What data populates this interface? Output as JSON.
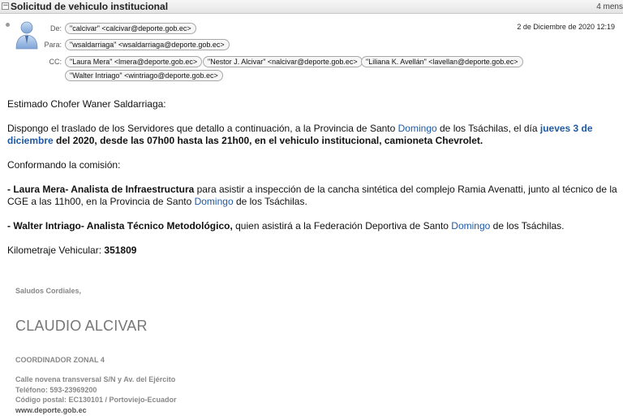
{
  "header": {
    "subject": "Solicitud de vehiculo institucional",
    "message_count": "4 mens",
    "date": "2 de Diciembre de 2020 12:19",
    "from_label": "De:",
    "to_label": "Para:",
    "cc_label": "CC:",
    "from": "\"calcivar\" <calcivar@deporte.gob.ec>",
    "to": "\"wsaldarriaga\" <wsaldarriaga@deporte.gob.ec>",
    "cc": [
      "\"Laura Mera\" <lmera@deporte.gob.ec>",
      "\"Nestor J. Alcivar\" <nalcivar@deporte.gob.ec>",
      "\"Liliana K. Avellán\" <lavellan@deporte.gob.ec>",
      "\"Walter Intriago\" <wintriago@deporte.gob.ec>"
    ]
  },
  "body": {
    "greeting": "Estimado Chofer Waner Saldarriaga:",
    "p1_a": "Dispongo el traslado de los Servidores  que detallo a continuación, a la Provincia de Santo ",
    "p1_link1": "Domingo",
    "p1_b": " de los Tsáchilas,  el día ",
    "p1_link2": "jueves 3 de diciembre",
    "p1_c": " del 2020, desde las 07h00 hasta las 21h00, en  el vehiculo institucional, camioneta Chevrolet.",
    "p2": "Conformando la comisión:",
    "p3_bold": "- Laura Mera- Analista de Infraestructura",
    "p3_a": " para asistir a inspección de la cancha sintética del complejo Ramia Avenatti, junto al técnico de la CGE a las 11h00, en la Provincia de Santo ",
    "p3_link": "Domingo",
    "p3_b": " de los Tsáchilas.",
    "p4_bold": "- Walter Intriago- Analista Técnico Metodológico,",
    "p4_a": "  quien asistirá a la Federación Deportiva de Santo ",
    "p4_link": "Domingo",
    "p4_b": " de los Tsáchilas.",
    "km_label": "Kilometraje Vehicular: ",
    "km_value": "351809"
  },
  "signature": {
    "closing": "Saludos Cordiales,",
    "name": "CLAUDIO ALCIVAR",
    "role": "COORDINADOR ZONAL 4",
    "address": "Calle novena transversal S/N y Av. del Ejército",
    "phone": "Teléfono: 593-23969200",
    "postal": "Código postal: EC130101 / Portoviejo-Ecuador",
    "website": "www.deporte.gob.ec"
  },
  "colors": {
    "link": "#1f5aa6",
    "signature_gray": "#888888"
  }
}
